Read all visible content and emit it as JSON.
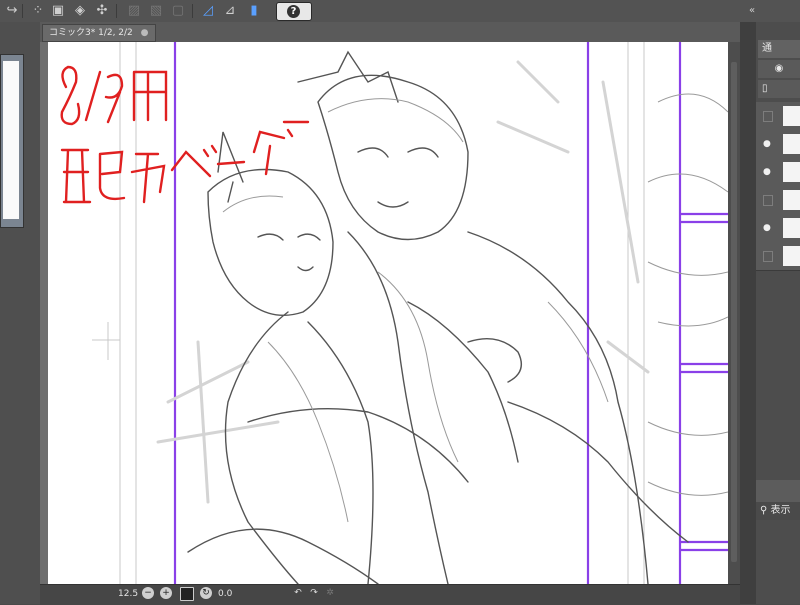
{
  "document_tab": {
    "title": "コミック3* 1/2, 2/2"
  },
  "canvas": {
    "handwritten_note": [
      "8/9用",
      "配布ペーパー"
    ],
    "note_color": "#e02020",
    "guide_color": "#8a40e8"
  },
  "statusbar": {
    "zoom": "12.5",
    "rotation": "0.0"
  },
  "right_panel": {
    "blend_mode_label": "通",
    "search_label": "表示"
  },
  "icons": {
    "help": "help-icon",
    "visibility": "eye-icon"
  }
}
